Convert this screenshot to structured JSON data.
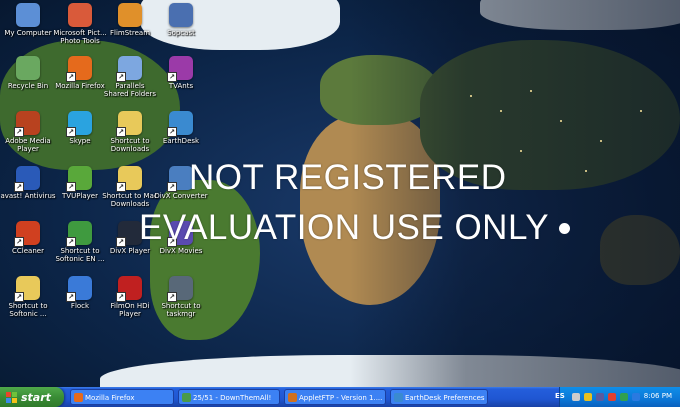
{
  "watermark": {
    "line1": "NOT REGISTERED",
    "line2": "EVALUATION USE ONLY"
  },
  "icons": [
    {
      "label": "My Computer",
      "icon": "computer-icon",
      "color": "#5c8fd6"
    },
    {
      "label": "Microsoft Pict... Photo Tools",
      "icon": "picture-icon",
      "color": "#d95a3a"
    },
    {
      "label": "FlimStream",
      "icon": "film-icon",
      "color": "#e0902a"
    },
    {
      "label": "Sopcast",
      "icon": "sopcast-icon",
      "color": "#4a6fb0"
    },
    {
      "label": "Recycle Bin",
      "icon": "recycle-bin-icon",
      "color": "#6aa860"
    },
    {
      "label": "Mozilla Firefox",
      "icon": "firefox-icon",
      "color": "#e56a1c"
    },
    {
      "label": "Parallels Shared Folders",
      "icon": "shared-folder-icon",
      "color": "#7da7e0"
    },
    {
      "label": "TVAnts",
      "icon": "tvants-icon",
      "color": "#9b3aa8"
    },
    {
      "label": "Adobe Media Player",
      "icon": "media-player-icon",
      "color": "#b8421f"
    },
    {
      "label": "Skype",
      "icon": "skype-icon",
      "color": "#2aa3e0"
    },
    {
      "label": "Shortcut to Downloads",
      "icon": "folder-icon",
      "color": "#e8c95a"
    },
    {
      "label": "EarthDesk",
      "icon": "earth-icon",
      "color": "#3a8ad0"
    },
    {
      "label": "avast! Antivirus",
      "icon": "avast-icon",
      "color": "#2a5ab8"
    },
    {
      "label": "TVUPlayer",
      "icon": "tvu-icon",
      "color": "#59a83a"
    },
    {
      "label": "Shortcut to Mac Downloads",
      "icon": "folder-icon",
      "color": "#e8c95a"
    },
    {
      "label": "DivX Converter",
      "icon": "divx-converter-icon",
      "color": "#4a7ec0"
    },
    {
      "label": "CCleaner",
      "icon": "ccleaner-icon",
      "color": "#d04020"
    },
    {
      "label": "Shortcut to Softonic EN ...",
      "icon": "spreadsheet-icon",
      "color": "#3f9a3f"
    },
    {
      "label": "DivX Player",
      "icon": "divx-player-icon",
      "color": "#222a3a"
    },
    {
      "label": "DivX Movies",
      "icon": "divx-movies-icon",
      "color": "#5a4ab0"
    },
    {
      "label": "Shortcut to Softonic ...",
      "icon": "folder-icon",
      "color": "#e8c95a"
    },
    {
      "label": "Flock",
      "icon": "flock-icon",
      "color": "#3a7ad8"
    },
    {
      "label": "FilmOn HDi Player",
      "icon": "filmon-icon",
      "color": "#c02020"
    },
    {
      "label": "Shortcut to taskmgr",
      "icon": "task-manager-icon",
      "color": "#586878"
    }
  ],
  "taskbar": {
    "start_label": "start",
    "buttons": [
      {
        "label": "Mozilla Firefox",
        "icon": "firefox-icon",
        "color": "#e56a1c"
      },
      {
        "label": "25/51 - DownThemAll!",
        "icon": "download-icon",
        "color": "#4a9a4a"
      },
      {
        "label": "AppletFTP - Version 1....",
        "icon": "ftp-icon",
        "color": "#d07020"
      },
      {
        "label": "EarthDesk Preferences",
        "icon": "earth-icon",
        "color": "#3a8ad0"
      }
    ],
    "language": "ES",
    "clock": "8:06 PM"
  }
}
